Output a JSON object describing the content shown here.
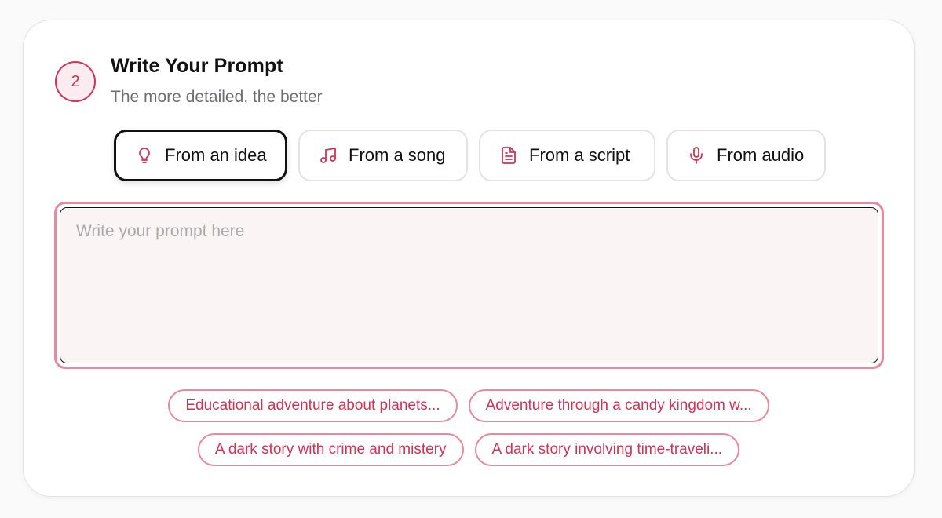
{
  "step": {
    "number": "2",
    "title": "Write Your Prompt",
    "subtitle": "The more detailed, the better"
  },
  "modes": [
    {
      "label": "From an idea",
      "icon": "lightbulb-icon",
      "active": true
    },
    {
      "label": "From a song",
      "icon": "music-note-icon",
      "active": false
    },
    {
      "label": "From a script",
      "icon": "document-icon",
      "active": false
    },
    {
      "label": "From audio",
      "icon": "microphone-icon",
      "active": false
    }
  ],
  "prompt": {
    "value": "",
    "placeholder": "Write your prompt here"
  },
  "suggestions": [
    "Educational adventure about planets...",
    "Adventure through a candy kingdom w...",
    "A dark story with crime and mistery",
    "A dark story involving time-traveli..."
  ],
  "colors": {
    "accent": "#cf3457",
    "accent_light": "#e68a9d",
    "badge_bg": "#fcecef",
    "input_bg": "#fbf4f4"
  }
}
